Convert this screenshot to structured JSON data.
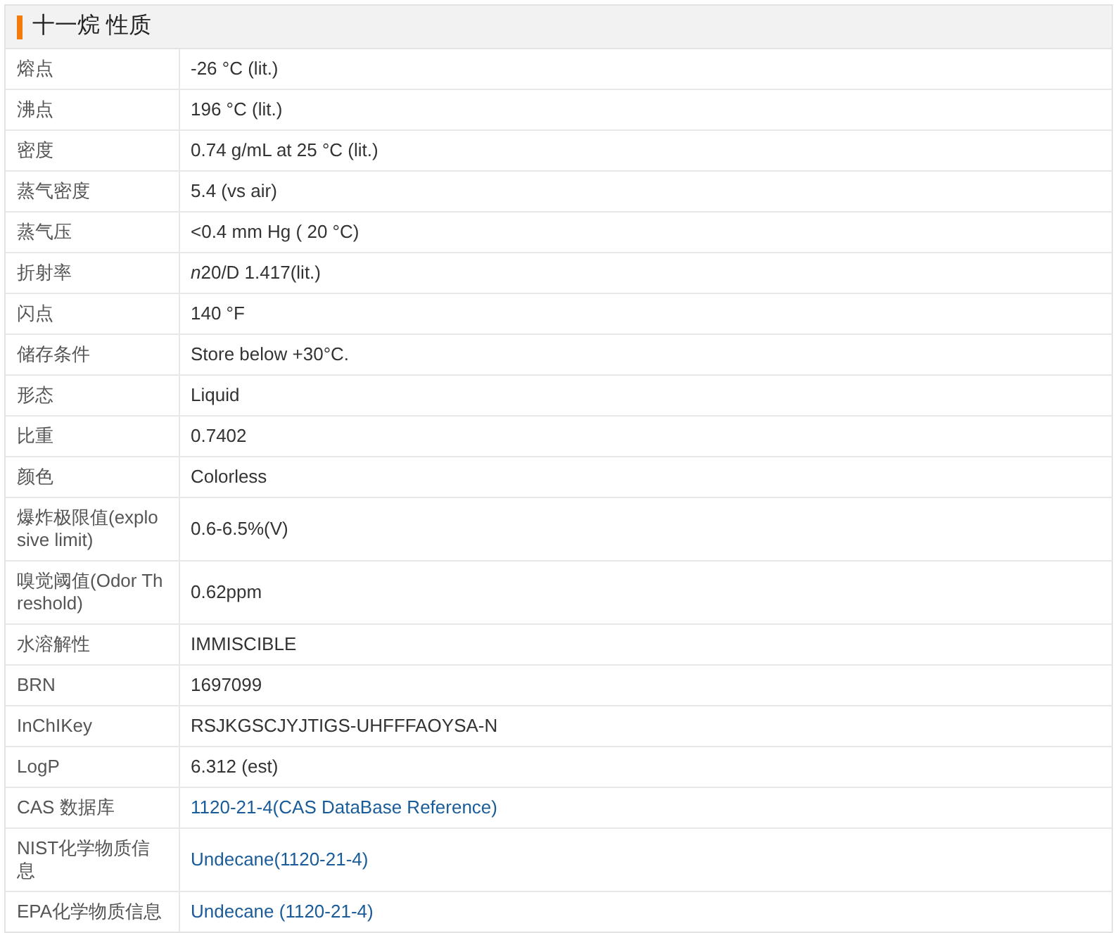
{
  "title": "十一烷 性质",
  "rows": [
    {
      "label": "熔点",
      "value": "-26 °C (lit.)",
      "link": false
    },
    {
      "label": "沸点",
      "value": "196 °C (lit.)",
      "link": false
    },
    {
      "label": "密度",
      "value": "0.74 g/mL at 25 °C (lit.)",
      "link": false
    },
    {
      "label": "蒸气密度",
      "value": "5.4 (vs air)",
      "link": false
    },
    {
      "label": "蒸气压",
      "value": "<0.4 mm Hg ( 20 °C)",
      "link": false
    },
    {
      "label": "折射率",
      "italic_lead": "n",
      "value": "20/D 1.417(lit.)",
      "link": false
    },
    {
      "label": "闪点",
      "value": "140 °F",
      "link": false
    },
    {
      "label": "储存条件",
      "value": "Store below +30°C.",
      "link": false
    },
    {
      "label": "形态",
      "value": "Liquid",
      "link": false
    },
    {
      "label": "比重",
      "value": "0.7402",
      "link": false
    },
    {
      "label": "颜色",
      "value": "Colorless",
      "link": false
    },
    {
      "label": "爆炸极限值(explosive limit)",
      "value": "0.6-6.5%(V)",
      "link": false
    },
    {
      "label": "嗅觉阈值(Odor Threshold)",
      "value": "0.62ppm",
      "link": false
    },
    {
      "label": "水溶解性",
      "value": "IMMISCIBLE",
      "link": false
    },
    {
      "label": "BRN",
      "value": "1697099",
      "link": false
    },
    {
      "label": "InChIKey",
      "value": "RSJKGSCJYJTIGS-UHFFFAOYSA-N",
      "link": false
    },
    {
      "label": "LogP",
      "value": "6.312 (est)",
      "link": false
    },
    {
      "label": "CAS 数据库",
      "value": "1120-21-4(CAS DataBase Reference)",
      "link": true
    },
    {
      "label": "NIST化学物质信息",
      "value": "Undecane(1120-21-4)",
      "link": true
    },
    {
      "label": "EPA化学物质信息",
      "value": "Undecane (1120-21-4)",
      "link": true
    }
  ]
}
